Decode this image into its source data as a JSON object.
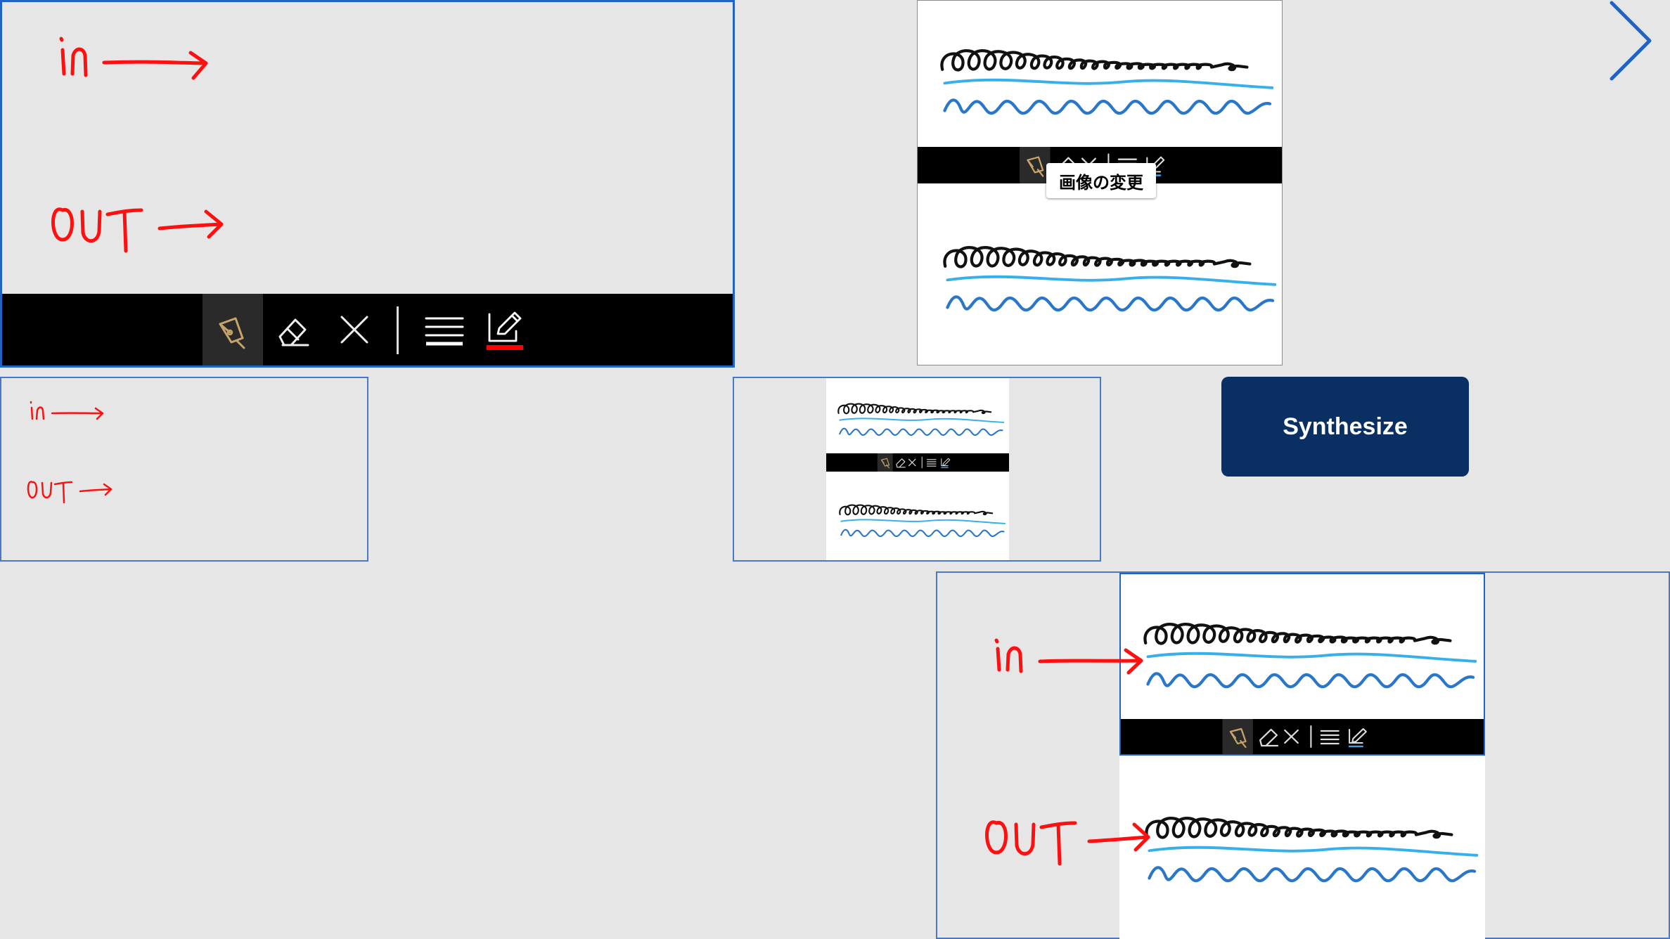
{
  "tooltip_text": "画像の変更",
  "synthesize_label": "Synthesize",
  "colors": {
    "background": "#e6e6e6",
    "toolbar": "#000000",
    "accent_blue": "#1f63c6",
    "button": "#0a2f63",
    "ink_red": "#ff0000",
    "pen_icon": "#c8a46a"
  },
  "pen_input": {
    "handwriting": [
      "in",
      "out"
    ],
    "toolbar_tools": [
      "pen-icon",
      "eraser-icon",
      "clear-icon",
      "stroke-width-icon",
      "pen-color-icon"
    ]
  },
  "navigation": {
    "next_icon": "chevron-right-icon"
  }
}
